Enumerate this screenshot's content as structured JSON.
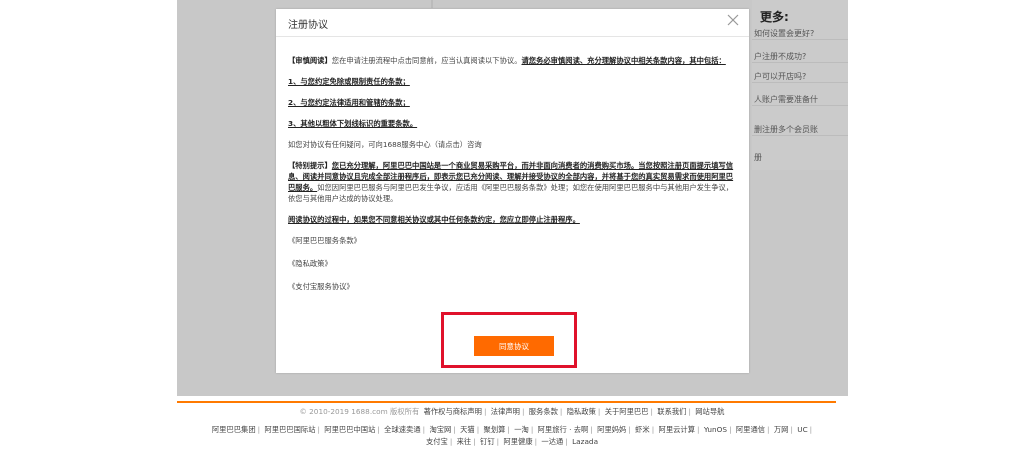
{
  "background": {
    "sidebar_title": "更多:",
    "sidebar_items": [
      "如何设置会更好?",
      "户注册不成功?",
      "户可以开店吗?",
      "人账户需要准备什",
      "删注册多个会员账",
      "册"
    ]
  },
  "modal": {
    "title": "注册协议",
    "close_icon": "close-icon",
    "paragraph1": {
      "label": "【审慎阅读】",
      "text": "您在申请注册流程中点击同意前，应当认真阅读以下协议。",
      "bold_text": "请您务必审慎阅读、充分理解协议中相关条款内容，其中包括："
    },
    "items": [
      "1、与您约定免除或限制责任的条款；",
      "2、与您约定法律适用和管辖的条款；",
      "3、其他以粗体下划线标识的重要条款。"
    ],
    "contact": "如您对协议有任何疑问，可向1688服务中心（请点击）咨询",
    "paragraph2": {
      "label": "【特别提示】",
      "bold_text": "您已充分理解，阿里巴巴中国站是一个商业贸易采购平台，而并非面向消费者的消费购买市场。当您按照注册页面提示填写信息、阅读并同意协议且完成全部注册程序后，即表示您已充分阅读、理解并接受协议的全部内容，并将基于您的真实贸易需求而使用阿里巴巴服务。",
      "text": "如您因阿里巴巴服务与阿里巴巴发生争议，应适用《阿里巴巴服务条款》处理；如您在使用阿里巴巴服务中与其他用户发生争议，依您与其他用户达成的协议处理。"
    },
    "warning": "阅读协议的过程中，如果您不同意相关协议或其中任何条款约定，您应立即停止注册程序。",
    "links": [
      "《阿里巴巴服务条款》",
      "《隐私政策》",
      "《支付宝服务协议》"
    ],
    "agree_button": "同意协议"
  },
  "footer": {
    "copyright": "© 2010-2019 1688.com 版权所有",
    "row1_links": [
      "著作权与商标声明",
      "法律声明",
      "服务条款",
      "隐私政策",
      "关于阿里巴巴",
      "联系我们",
      "网站导航"
    ],
    "row2_links": [
      "阿里巴巴集团",
      "阿里巴巴国际站",
      "阿里巴巴中国站",
      "全球速卖通",
      "淘宝网",
      "天猫",
      "聚划算",
      "一淘",
      "阿里旅行 · 去啊",
      "阿里妈妈",
      "虾米",
      "阿里云计算",
      "YunOS",
      "阿里通信",
      "万网",
      "UC"
    ],
    "row3_links": [
      "支付宝",
      "来往",
      "钉钉",
      "阿里健康",
      "一达通",
      "Lazada"
    ]
  },
  "colors": {
    "accent": "#ff6a00",
    "highlight_border": "#e0112b",
    "overlay": "#c8c8c8"
  }
}
